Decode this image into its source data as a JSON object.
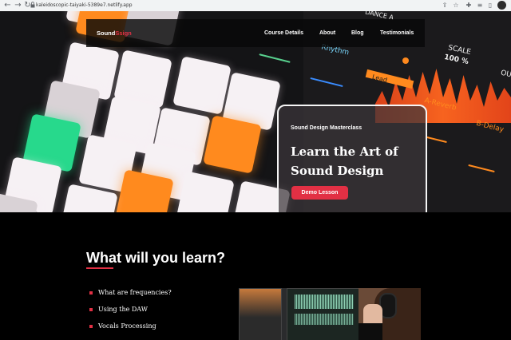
{
  "browser": {
    "url": "kaleidoscopic-taiyaki-5389e7.netlify.app",
    "back_icon": "arrow-left-icon",
    "forward_icon": "arrow-right-icon",
    "reload_icon": "reload-icon",
    "toolbar_icons": [
      "share-icon",
      "star-icon",
      "extensions-icon",
      "cast-icon",
      "sidebar-icon",
      "profile-icon"
    ]
  },
  "nav": {
    "brand_main": "Sound",
    "brand_accent": "Ssign",
    "links": [
      "Course Details",
      "About",
      "Blog",
      "Testimonials"
    ]
  },
  "hero": {
    "background_labels": [
      "Rhythm",
      "SCALE",
      "100 %",
      "Lead",
      "A-Reverb",
      "B-Delay",
      "OU",
      "DANCE A"
    ],
    "kicker": "Sound Design Masterclass",
    "title": "Learn the Art of Sound Design",
    "cta_label": "Demo Lesson"
  },
  "section": {
    "title": "What will you learn?",
    "items": [
      "What are frequencies?",
      "Using the DAW",
      "Vocals Processing"
    ]
  },
  "colors": {
    "accent": "#e23044",
    "background": "#000000",
    "card_border": "#f5f5f5"
  }
}
